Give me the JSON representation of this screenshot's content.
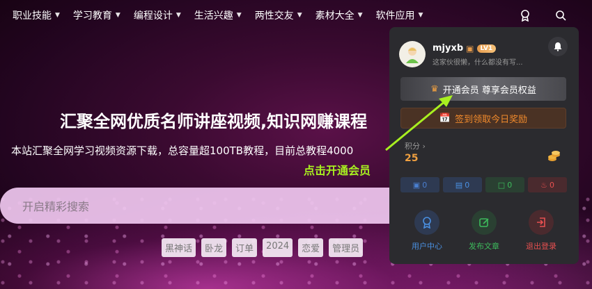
{
  "nav": {
    "items": [
      {
        "label": "职业技能"
      },
      {
        "label": "学习教育"
      },
      {
        "label": "编程设计"
      },
      {
        "label": "生活兴趣"
      },
      {
        "label": "两性交友"
      },
      {
        "label": "素材大全"
      },
      {
        "label": "软件应用"
      }
    ],
    "icons": [
      "badge-icon",
      "search-icon"
    ]
  },
  "hero": {
    "title": "汇聚全网优质名师讲座视频,知识网赚课程",
    "subtitle": "本站汇聚全网学习视频资源下载，总容量超100TB教程，目前总教程4000",
    "hint": "点击开通会员"
  },
  "search": {
    "placeholder": "开启精彩搜索"
  },
  "tags": [
    "黑神话",
    "卧龙",
    "订单",
    "2024",
    "恋爱",
    "管理员"
  ],
  "panel": {
    "username": "mjyxb",
    "level": "LV1",
    "bio": "这家伙很懒，什么都没有写...",
    "vip_label": "开通会员 尊享会员权益",
    "checkin_label": "签到领取今日奖励",
    "points_label": "积分",
    "points_value": "25",
    "stats": [
      {
        "icon": "comment-icon",
        "value": "0",
        "color": "#4a7fd0",
        "bg": "#2e3a52"
      },
      {
        "icon": "document-icon",
        "value": "0",
        "color": "#4a90e2",
        "bg": "#2e3a52"
      },
      {
        "icon": "message-icon",
        "value": "0",
        "color": "#3dbb5c",
        "bg": "#2a4032"
      },
      {
        "icon": "fire-icon",
        "value": "0",
        "color": "#e85050",
        "bg": "#4a2a2e"
      }
    ],
    "actions": [
      {
        "label": "用户中心",
        "icon": "user-badge-icon",
        "color": "#4a90e2",
        "bg": "#2e3a52"
      },
      {
        "label": "发布文章",
        "icon": "edit-icon",
        "color": "#3dbb5c",
        "bg": "#2a4032"
      },
      {
        "label": "退出登录",
        "icon": "logout-icon",
        "color": "#e85050",
        "bg": "#4a2a2e"
      }
    ]
  }
}
